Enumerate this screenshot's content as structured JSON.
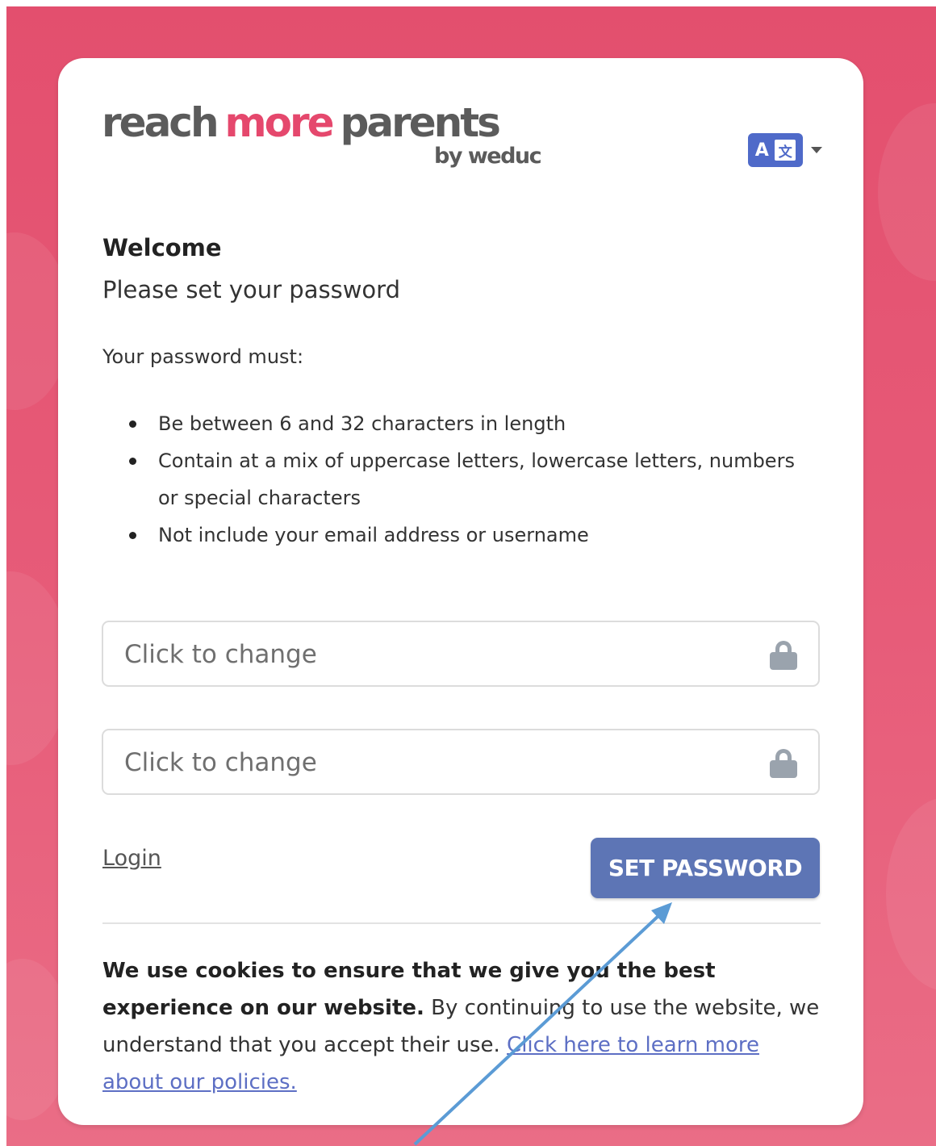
{
  "brand": {
    "logo_part1": "reach",
    "logo_part2": "more",
    "logo_part3": "parents",
    "logo_sub": "by weduc",
    "accent_color": "#e5486d",
    "primary_color": "#5d75b5"
  },
  "language": {
    "icon": "translate-icon",
    "glyph_a": "A",
    "glyph_b": "文"
  },
  "heading": {
    "welcome": "Welcome",
    "subtitle": "Please set your password"
  },
  "rules": {
    "intro": "Your password must:",
    "items": [
      "Be between 6 and 32 characters in length",
      "Contain at a mix of uppercase letters, lowercase letters, numbers or special characters",
      "Not include your email address or username"
    ]
  },
  "form": {
    "password_placeholder": "Click to change",
    "confirm_placeholder": "Click to change",
    "lock_icon": "lock-icon",
    "login_label": "Login",
    "submit_label": "SET PASSWORD"
  },
  "cookies": {
    "bold_text": "We use cookies to ensure that we give you the best experience on our website.",
    "text": " By continuing to use the website, we understand that you accept their use. ",
    "link_text": "Click here to learn more about our policies."
  },
  "annotation": {
    "arrow_color": "#5b9bd5"
  }
}
